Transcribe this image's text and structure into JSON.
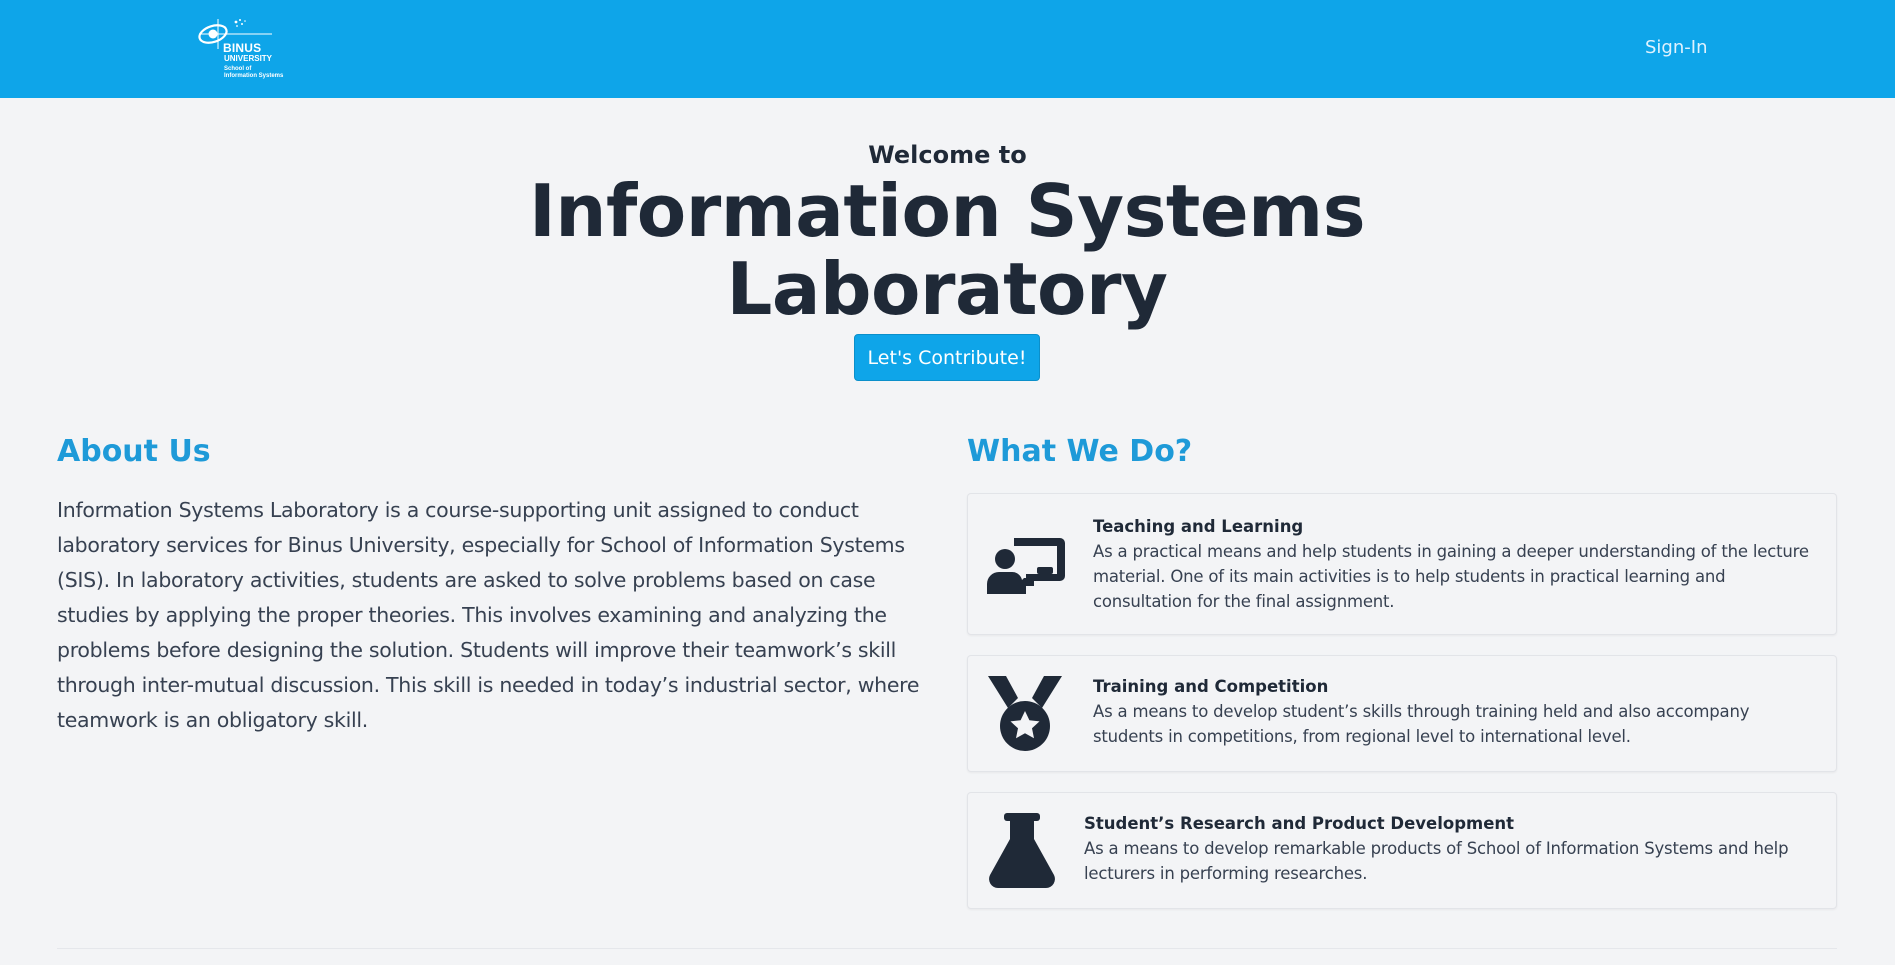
{
  "header": {
    "logo": {
      "brand": "BINUS",
      "brand_line2": "UNIVERSITY",
      "sub_line1": "School of",
      "sub_line2": "Information Systems"
    },
    "signin_label": "Sign-In"
  },
  "hero": {
    "pre_title": "Welcome to",
    "title": "Information Systems Laboratory",
    "cta_label": "Let's Contribute!"
  },
  "about": {
    "title": "About Us",
    "text": "Information Systems Laboratory is a course-supporting unit assigned to conduct laboratory services for Binus University, especially for School of Information Systems (SIS). In laboratory activities, students are asked to solve problems based on case studies by applying the proper theories. This involves examining and analyzing the problems before designing the solution. Students will improve their teamwork’s skill through inter-mutual discussion. This skill is needed in today’s industrial sector, where teamwork is an obligatory skill."
  },
  "what_we_do": {
    "title": "What We Do?",
    "items": [
      {
        "icon": "chalkboard-teacher-icon",
        "title": "Teaching and Learning",
        "desc": "As a practical means and help students in gaining a deeper understanding of the lecture material. One of its main activities is to help students in practical learning and consultation for the final assignment."
      },
      {
        "icon": "medal-icon",
        "title": "Training and Competition",
        "desc": "As a means to develop student’s skills through training held and also accompany students in competitions, from regional level to international level."
      },
      {
        "icon": "flask-icon",
        "title": "Student’s Research and Product Development",
        "desc": "As a means to develop remarkable products of School of Information Systems and help lecturers in performing researches."
      }
    ]
  },
  "colors": {
    "navbar": "#0ea5e9",
    "accent": "#1e9ad8",
    "background": "#f3f4f6",
    "text": "#1f2937"
  }
}
